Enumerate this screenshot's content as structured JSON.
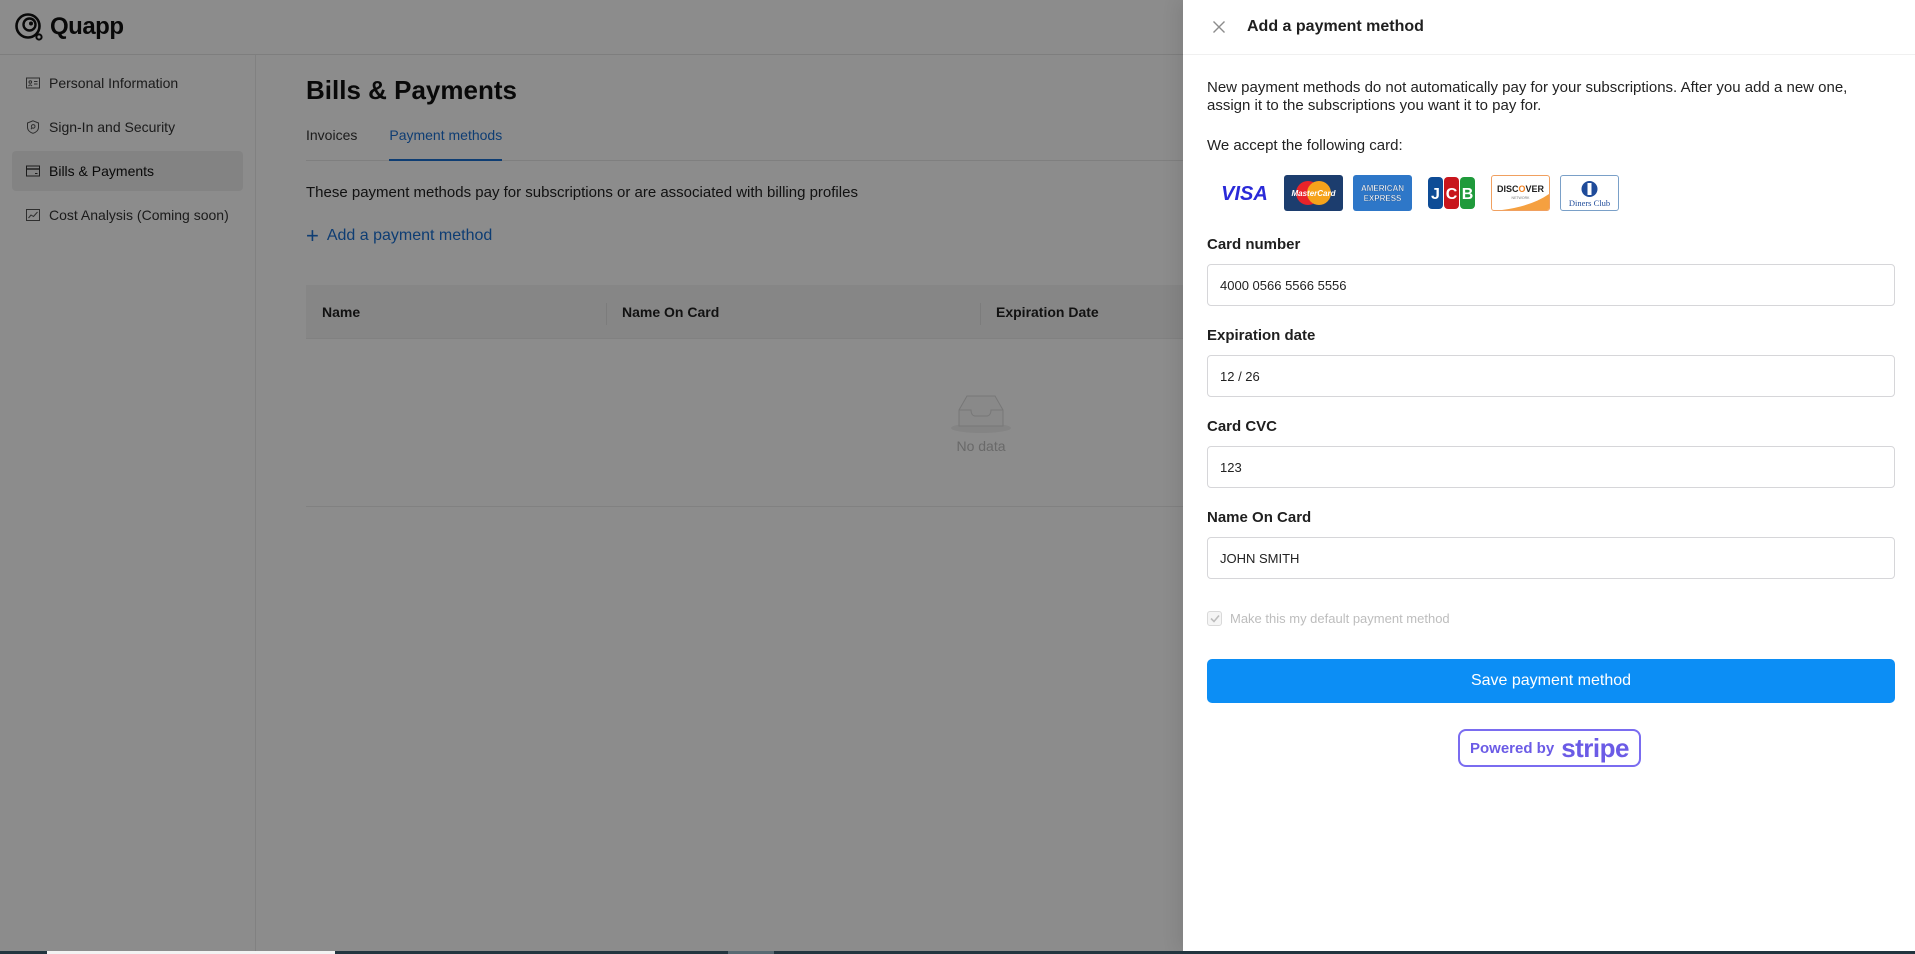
{
  "app": {
    "name": "Quapp",
    "logo_icon": "quapp-logo-icon"
  },
  "sidebar": {
    "items": [
      {
        "label": "Personal Information",
        "icon": "id-card-icon",
        "active": false
      },
      {
        "label": "Sign-In and Security",
        "icon": "shield-icon",
        "active": false
      },
      {
        "label": "Bills & Payments",
        "icon": "credit-card-icon",
        "active": true
      },
      {
        "label": "Cost Analysis (Coming soon)",
        "icon": "line-chart-icon",
        "active": false
      }
    ]
  },
  "main": {
    "title": "Bills & Payments",
    "tabs": [
      {
        "label": "Invoices",
        "active": false
      },
      {
        "label": "Payment methods",
        "active": true
      }
    ],
    "description": "These payment methods pay for subscriptions or are associated with billing profiles",
    "add_link": {
      "icon": "plus-icon",
      "label": "Add a payment method"
    },
    "table": {
      "columns": [
        "Name",
        "Name On Card",
        "Expiration Date"
      ],
      "rows": [],
      "empty_text": "No data",
      "empty_icon": "empty-inbox-icon"
    }
  },
  "drawer": {
    "title": "Add a payment method",
    "close_icon": "close-icon",
    "intro": "New payment methods do not automatically pay for your subscriptions. After you add a new one, assign it to the subscriptions you want it to pay for.",
    "accept_text": "We accept the following card:",
    "accepted_cards": [
      {
        "name": "VISA",
        "icon": "visa-logo-icon"
      },
      {
        "name": "MasterCard",
        "icon": "mastercard-logo-icon"
      },
      {
        "name": "American Express",
        "icon": "amex-logo-icon"
      },
      {
        "name": "JCB",
        "icon": "jcb-logo-icon"
      },
      {
        "name": "DISCOVER",
        "icon": "discover-logo-icon"
      },
      {
        "name": "Diners Club",
        "icon": "diners-club-logo-icon"
      }
    ],
    "fields": {
      "card_number": {
        "label": "Card number",
        "value": "4000 0566 5566 5556"
      },
      "expiration": {
        "label": "Expiration date",
        "value": "12 / 26"
      },
      "cvc": {
        "label": "Card CVC",
        "value": "123"
      },
      "name_on_card": {
        "label": "Name On Card",
        "value": "JOHN SMITH"
      }
    },
    "default_checkbox": {
      "label": "Make this my default payment method",
      "checked": true,
      "disabled": true
    },
    "save_button": "Save payment method",
    "stripe_badge": {
      "prefix": "Powered by",
      "brand": "stripe"
    }
  },
  "colors": {
    "accent": "#1a6fd1",
    "primary_button": "#0c8ef5",
    "stripe": "#6b5be6",
    "mask": "rgba(0,0,0,0.45)"
  }
}
